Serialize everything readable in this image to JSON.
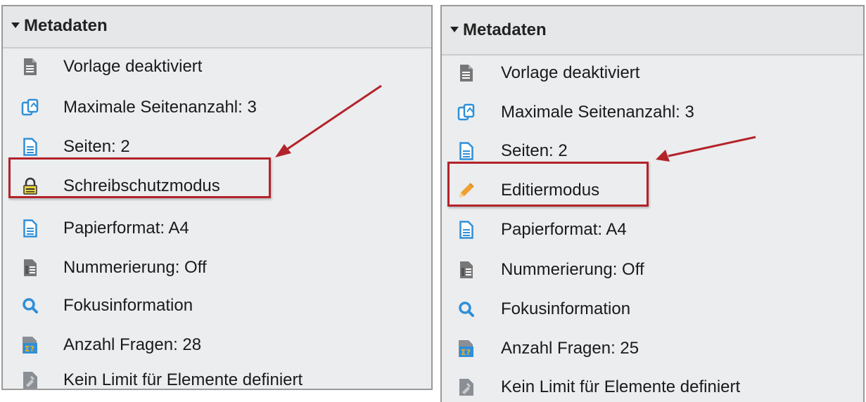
{
  "left_panel": {
    "title": "Metadaten",
    "items": [
      {
        "icon": "template-document-icon",
        "label": "Vorlage deaktiviert"
      },
      {
        "icon": "max-pages-icon",
        "label": "Maximale Seitenanzahl: 3"
      },
      {
        "icon": "pages-icon",
        "label": "Seiten: 2"
      },
      {
        "icon": "lock-icon",
        "label": "Schreibschutzmodus"
      },
      {
        "icon": "paper-format-icon",
        "label": "Papierformat: A4"
      },
      {
        "icon": "numbering-icon",
        "label": "Nummerierung: Off"
      },
      {
        "icon": "search-icon",
        "label": "Fokusinformation"
      },
      {
        "icon": "question-count-icon",
        "label": "Anzahl Fragen: 28"
      },
      {
        "icon": "element-limit-icon",
        "label": "Kein Limit für Elemente definiert"
      }
    ]
  },
  "right_panel": {
    "title": "Metadaten",
    "items": [
      {
        "icon": "template-document-icon",
        "label": "Vorlage deaktiviert"
      },
      {
        "icon": "max-pages-icon",
        "label": "Maximale Seitenanzahl: 3"
      },
      {
        "icon": "pages-icon",
        "label": "Seiten: 2"
      },
      {
        "icon": "pencil-icon",
        "label": "Editiermodus"
      },
      {
        "icon": "paper-format-icon",
        "label": "Papierformat: A4"
      },
      {
        "icon": "numbering-icon",
        "label": "Nummerierung: Off"
      },
      {
        "icon": "search-icon",
        "label": "Fokusinformation"
      },
      {
        "icon": "question-count-icon",
        "label": "Anzahl Fragen: 25"
      },
      {
        "icon": "element-limit-icon",
        "label": "Kein Limit für Elemente definiert"
      }
    ]
  },
  "colors": {
    "highlight": "#b3232a",
    "panel_bg": "#ebedef",
    "blue_icon": "#2f8fd8",
    "lock_yellow": "#e8d23a",
    "pencil_orange": "#f0a030"
  }
}
